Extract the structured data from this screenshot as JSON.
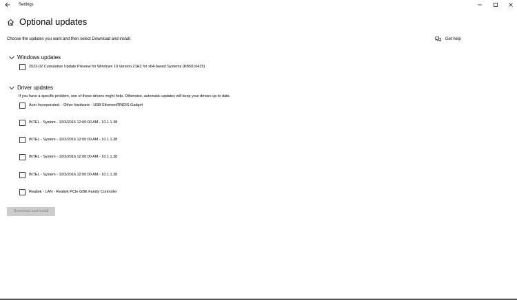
{
  "window": {
    "title": "Settings"
  },
  "page": {
    "title": "Optional updates",
    "subtitle": "Choose the updates you want and then select Download and install."
  },
  "help": {
    "label": "Get help"
  },
  "windows_updates": {
    "header": "Windows updates",
    "items": [
      {
        "label": "2022-02 Cumulative Update Preview for Windows 10 Version 21H2 for x64-based Systems (KB5010415)"
      }
    ]
  },
  "driver_updates": {
    "header": "Driver updates",
    "note": "If you have a specific problem, one of these drivers might help. Otherwise, automatic updates will keep your drivers up to date.",
    "items": [
      {
        "label": "Acer Incorporated. - Other hardware - USB Ethernet/RNDIS Gadget"
      },
      {
        "label": "INTEL - System - 10/3/2016 12:00:00 AM - 10.1.1.38"
      },
      {
        "label": "INTEL - System - 10/3/2016 12:00:00 AM - 10.1.1.38"
      },
      {
        "label": "INTEL - System - 10/3/2016 12:00:00 AM - 10.1.1.38"
      },
      {
        "label": "INTEL - System - 10/3/2016 12:00:00 AM - 10.1.1.38"
      },
      {
        "label": "Realtek - LAN - Realtek PCIe GBE Family Controller"
      }
    ]
  },
  "actions": {
    "download_label": "Download and install"
  }
}
